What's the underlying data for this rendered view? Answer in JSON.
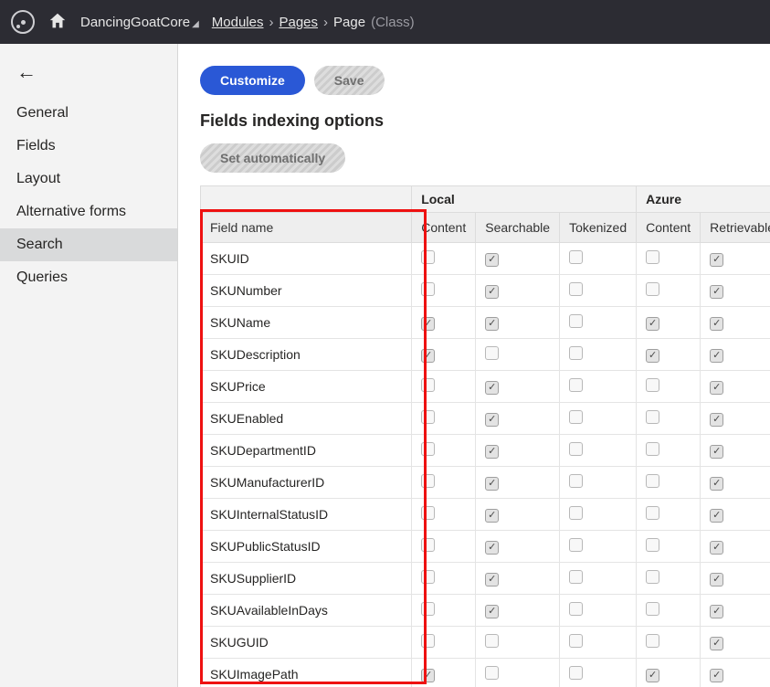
{
  "top": {
    "site": "DancingGoatCore",
    "crumbs": {
      "modules": "Modules",
      "pages": "Pages",
      "page": "Page",
      "suffix": "(Class)"
    }
  },
  "sidebar": {
    "items": [
      "General",
      "Fields",
      "Layout",
      "Alternative forms",
      "Search",
      "Queries"
    ],
    "active": "Search"
  },
  "buttons": {
    "customize": "Customize",
    "save": "Save",
    "setauto": "Set automatically"
  },
  "section_title": "Fields indexing options",
  "table": {
    "group_headers": {
      "local": "Local",
      "azure": "Azure"
    },
    "columns": {
      "field": "Field name",
      "local_content": "Content",
      "local_searchable": "Searchable",
      "local_tokenized": "Tokenized",
      "azure_content": "Content",
      "azure_retrievable": "Retrievable"
    },
    "rows": [
      {
        "name": "SKUID",
        "lc": false,
        "ls": true,
        "lt": false,
        "ac": false,
        "ar": true
      },
      {
        "name": "SKUNumber",
        "lc": false,
        "ls": true,
        "lt": false,
        "ac": false,
        "ar": true
      },
      {
        "name": "SKUName",
        "lc": true,
        "ls": true,
        "lt": false,
        "ac": true,
        "ar": true
      },
      {
        "name": "SKUDescription",
        "lc": true,
        "ls": false,
        "lt": false,
        "ac": true,
        "ar": true
      },
      {
        "name": "SKUPrice",
        "lc": false,
        "ls": true,
        "lt": false,
        "ac": false,
        "ar": true
      },
      {
        "name": "SKUEnabled",
        "lc": false,
        "ls": true,
        "lt": false,
        "ac": false,
        "ar": true
      },
      {
        "name": "SKUDepartmentID",
        "lc": false,
        "ls": true,
        "lt": false,
        "ac": false,
        "ar": true
      },
      {
        "name": "SKUManufacturerID",
        "lc": false,
        "ls": true,
        "lt": false,
        "ac": false,
        "ar": true
      },
      {
        "name": "SKUInternalStatusID",
        "lc": false,
        "ls": true,
        "lt": false,
        "ac": false,
        "ar": true
      },
      {
        "name": "SKUPublicStatusID",
        "lc": false,
        "ls": true,
        "lt": false,
        "ac": false,
        "ar": true
      },
      {
        "name": "SKUSupplierID",
        "lc": false,
        "ls": true,
        "lt": false,
        "ac": false,
        "ar": true
      },
      {
        "name": "SKUAvailableInDays",
        "lc": false,
        "ls": true,
        "lt": false,
        "ac": false,
        "ar": true
      },
      {
        "name": "SKUGUID",
        "lc": false,
        "ls": false,
        "lt": false,
        "ac": false,
        "ar": true
      },
      {
        "name": "SKUImagePath",
        "lc": true,
        "ls": false,
        "lt": false,
        "ac": true,
        "ar": true
      }
    ]
  }
}
